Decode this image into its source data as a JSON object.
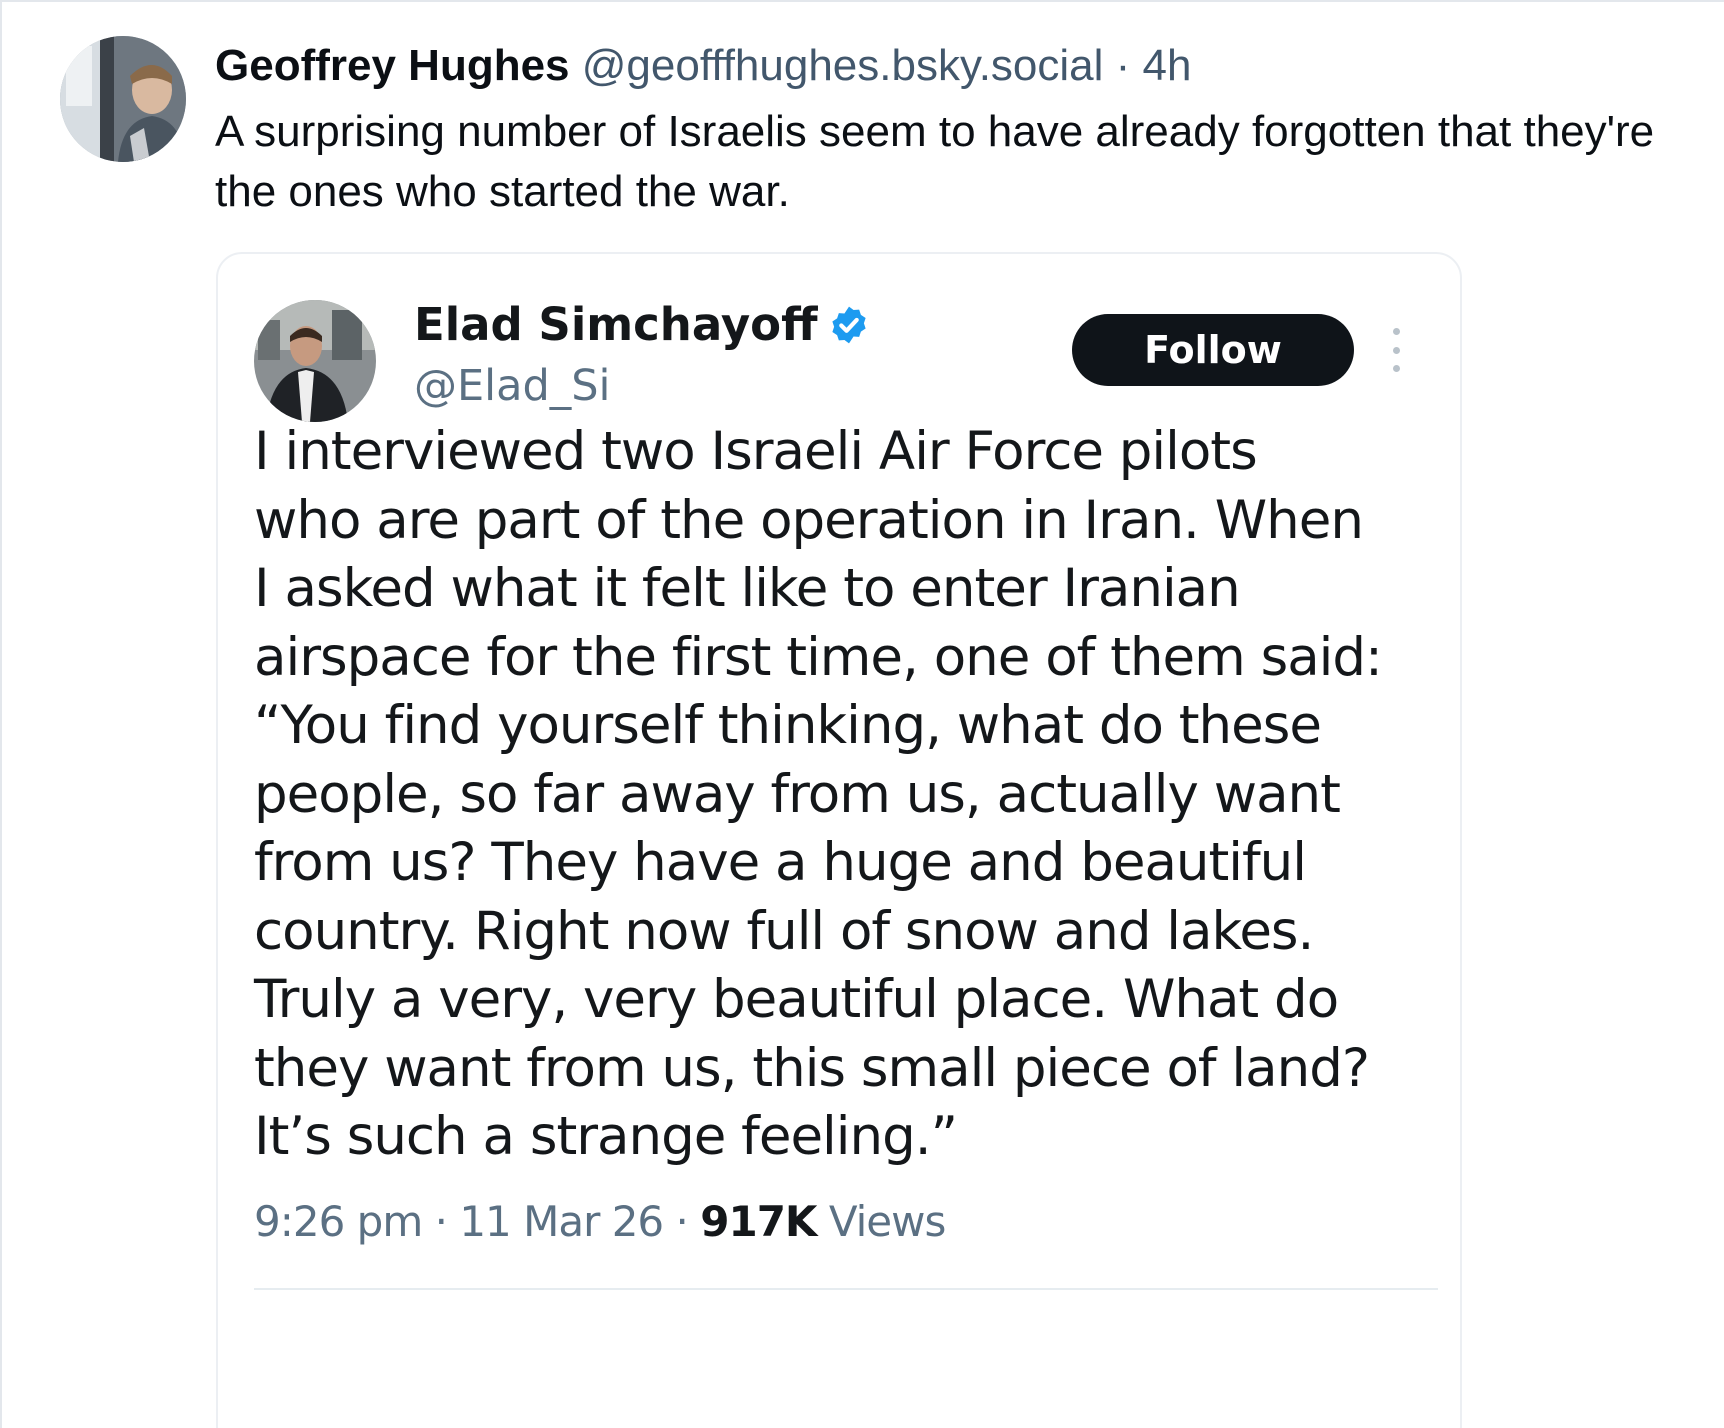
{
  "post": {
    "author_name": "Geoffrey Hughes",
    "handle": "@geofffhughes.bsky.social",
    "separator": "·",
    "time_ago": "4h",
    "text": "A surprising number of Israelis seem to have already forgotten that they're the ones who started the war.",
    "avatar_icon": "person-photo-avatar"
  },
  "embed": {
    "author_name": "Elad Simchayoff",
    "verified_icon": "verified-badge-icon",
    "verified_color": "#1d9bf0",
    "handle": "@Elad_Si",
    "follow_label": "Follow",
    "more_icon": "vertical-ellipsis-icon",
    "body": "I interviewed two Israeli Air Force pilots\nwho are part of the operation in Iran. When\nI asked what it felt like to enter Iranian\nairspace for the first time, one of them said:\n“You find yourself thinking, what do these\npeople, so far away from us, actually want\nfrom us? They have a huge and beautiful\ncountry. Right now full of snow and lakes.\nTruly a very, very beautiful place. What do\nthey want from us, this small piece of land?\nIt’s such a strange feeling.”",
    "time": "9:26 pm",
    "separator": "·",
    "date": "11 Mar 26",
    "views_count": "917K",
    "views_label": "Views",
    "avatar_icon": "person-photo-avatar"
  }
}
